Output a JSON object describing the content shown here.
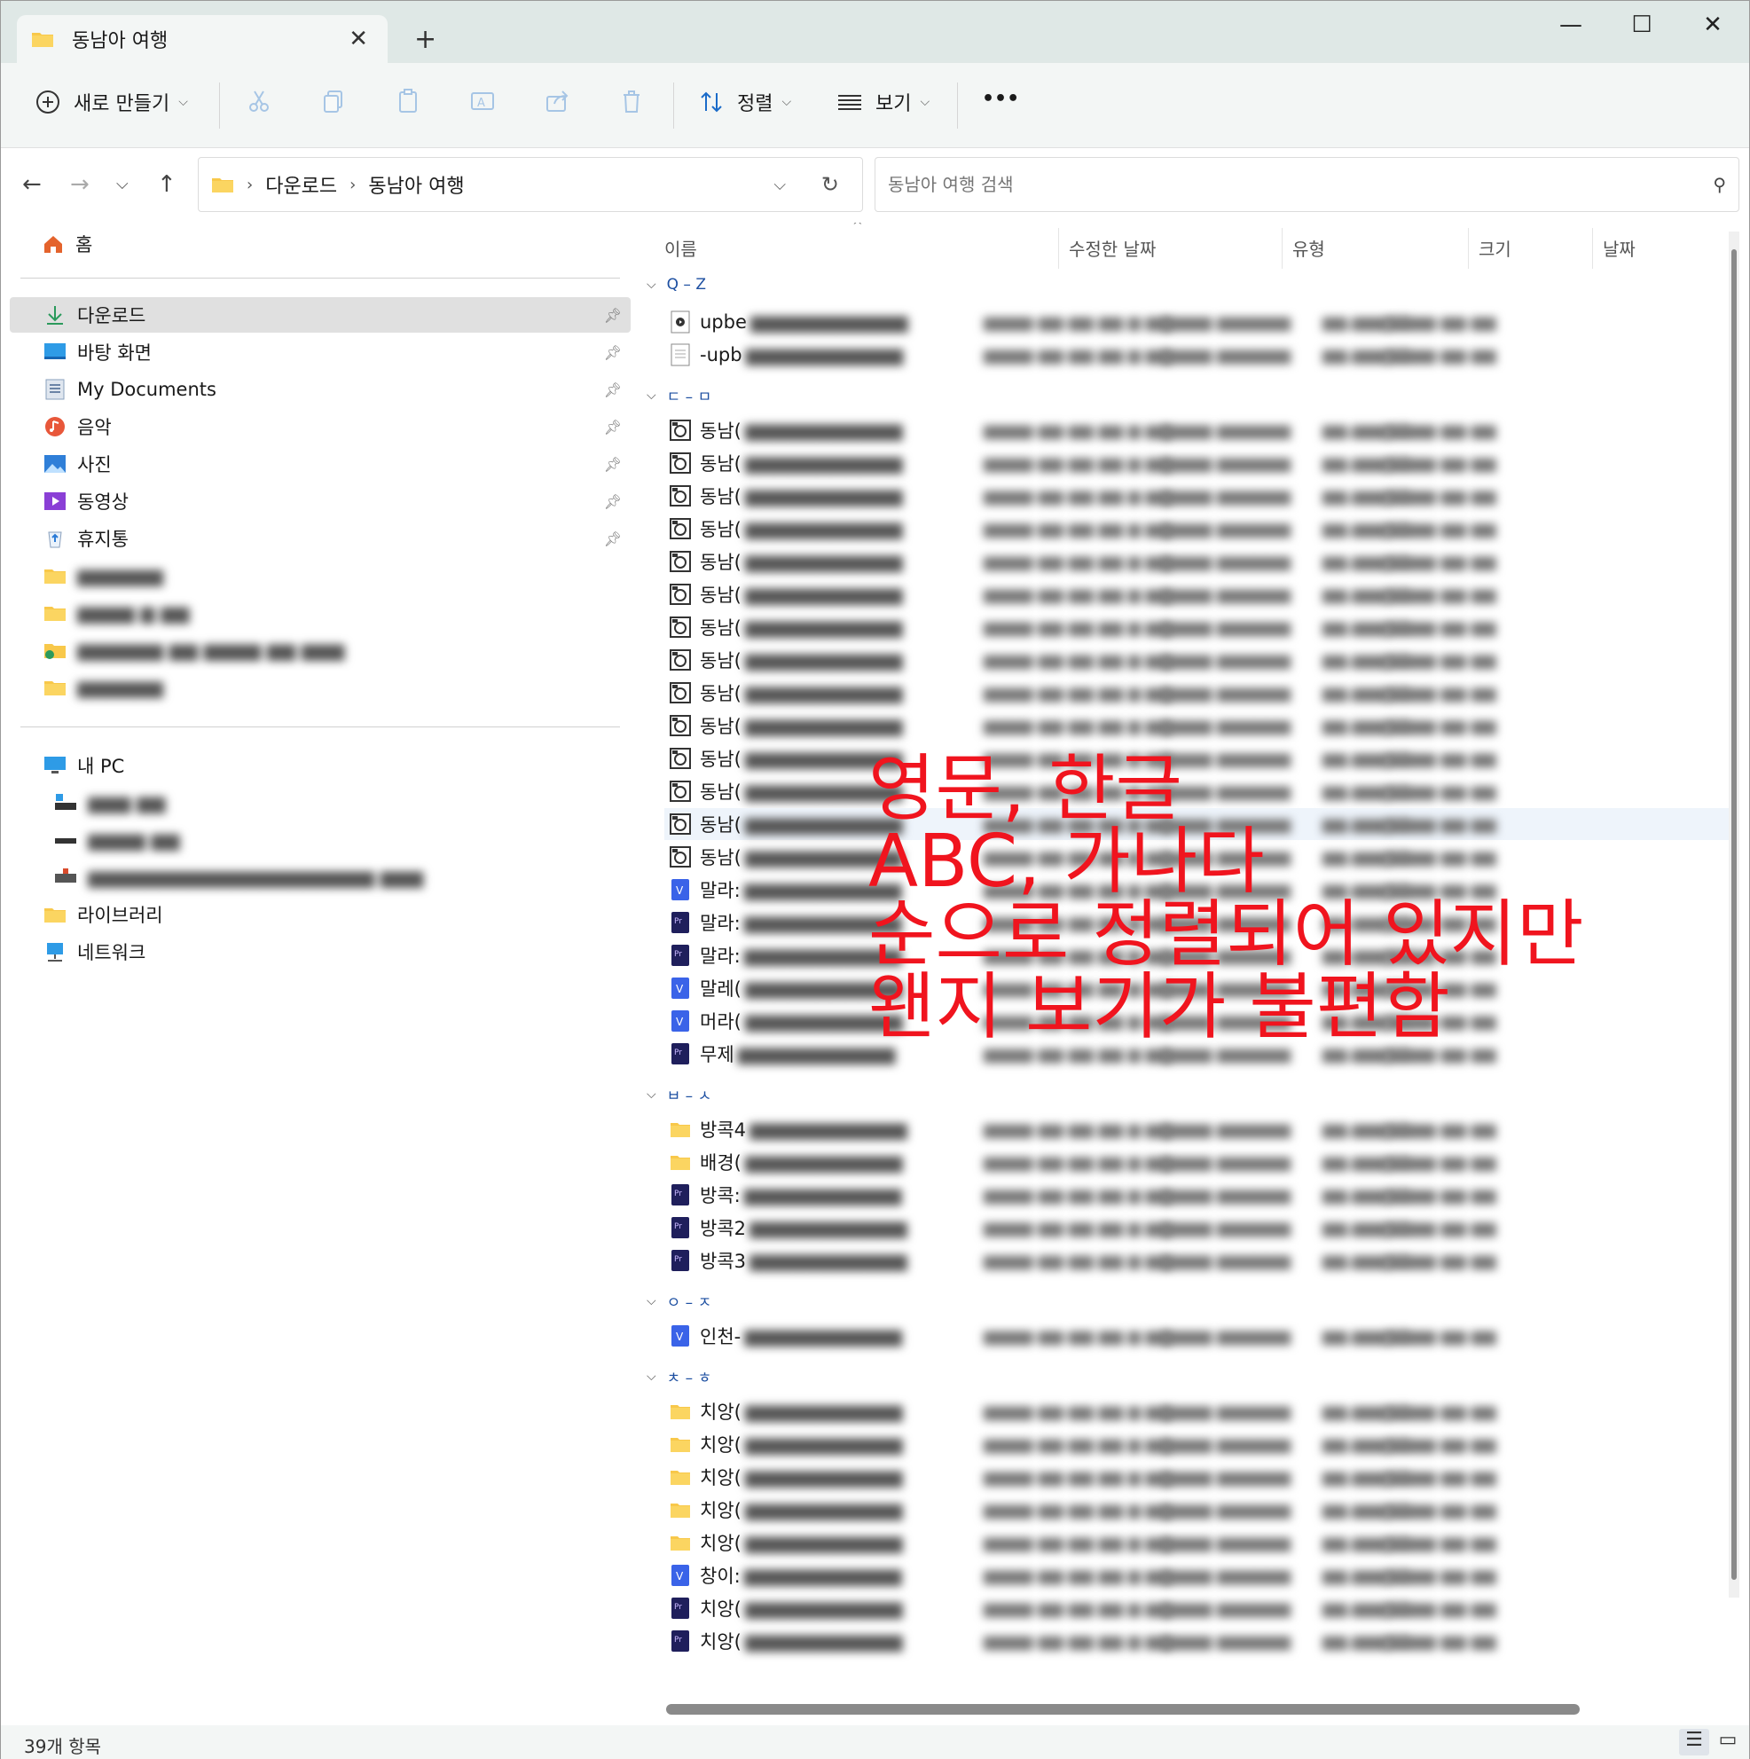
{
  "tab": {
    "title": "동남아 여행",
    "close": "✕",
    "new_tab": "+"
  },
  "window_controls": {
    "minimize": "—",
    "maximize": "☐",
    "close": "✕"
  },
  "commands": {
    "new": "새로 만들기",
    "sort": "정렬",
    "view": "보기",
    "more": "•••"
  },
  "address": {
    "crumbs": [
      "다운로드",
      "동남아 여행"
    ],
    "separator": "›"
  },
  "search": {
    "placeholder": "동남아 여행 검색"
  },
  "sidebar": {
    "home": "홈",
    "quick": [
      {
        "label": "다운로드",
        "icon": "download-icon",
        "pinned": true
      },
      {
        "label": "바탕 화면",
        "icon": "desktop-icon",
        "pinned": true
      },
      {
        "label": "My Documents",
        "icon": "documents-icon",
        "pinned": true
      },
      {
        "label": "음악",
        "icon": "music-icon",
        "pinned": true
      },
      {
        "label": "사진",
        "icon": "pictures-icon",
        "pinned": true
      },
      {
        "label": "동영상",
        "icon": "videos-icon",
        "pinned": true
      },
      {
        "label": "휴지통",
        "icon": "recycle-bin-icon",
        "pinned": true
      }
    ],
    "this_pc": "내 PC",
    "library": "라이브러리",
    "network": "네트워크"
  },
  "columns": {
    "name": "이름",
    "modified": "수정한 날짜",
    "type": "유형",
    "size": "크기",
    "date": "날짜"
  },
  "groups": [
    {
      "label": "Q – Z",
      "files": [
        {
          "name": "upbe",
          "icon": "media-file-icon"
        },
        {
          "name": "-upb",
          "icon": "text-file-icon"
        }
      ]
    },
    {
      "label": "ㄷ – ㅁ",
      "files": [
        {
          "name": "동남(",
          "icon": "image-file-icon"
        },
        {
          "name": "동남(",
          "icon": "image-file-icon"
        },
        {
          "name": "동남(",
          "icon": "image-file-icon"
        },
        {
          "name": "동남(",
          "icon": "image-file-icon"
        },
        {
          "name": "동남(",
          "icon": "image-file-icon"
        },
        {
          "name": "동남(",
          "icon": "image-file-icon"
        },
        {
          "name": "동남(",
          "icon": "image-file-icon"
        },
        {
          "name": "동남(",
          "icon": "image-file-icon"
        },
        {
          "name": "동남(",
          "icon": "image-file-icon"
        },
        {
          "name": "동남(",
          "icon": "image-file-icon"
        },
        {
          "name": "동남(",
          "icon": "image-file-icon"
        },
        {
          "name": "동남(",
          "icon": "image-file-icon"
        },
        {
          "name": "동남(",
          "icon": "image-file-icon"
        },
        {
          "name": "동남(",
          "icon": "image-file-icon"
        },
        {
          "name": "말라:",
          "icon": "vrew-file-icon"
        },
        {
          "name": "말라:",
          "icon": "premiere-file-icon"
        },
        {
          "name": "말라:",
          "icon": "premiere-file-icon"
        },
        {
          "name": "말레(",
          "icon": "vrew-file-icon"
        },
        {
          "name": "머라(",
          "icon": "vrew-file-icon"
        },
        {
          "name": "무제",
          "icon": "premiere-file-icon"
        }
      ]
    },
    {
      "label": "ㅂ – ㅅ",
      "files": [
        {
          "name": "방콕4",
          "icon": "folder-icon"
        },
        {
          "name": "배경(",
          "icon": "folder-icon"
        },
        {
          "name": "방콕:",
          "icon": "premiere-file-icon"
        },
        {
          "name": "방콕2",
          "icon": "premiere-file-icon"
        },
        {
          "name": "방콕3",
          "icon": "premiere-file-icon"
        }
      ]
    },
    {
      "label": "ㅇ – ㅈ",
      "files": [
        {
          "name": "인천-",
          "icon": "vrew-file-icon"
        }
      ]
    },
    {
      "label": "ㅊ – ㅎ",
      "files": [
        {
          "name": "치앙(",
          "icon": "folder-icon"
        },
        {
          "name": "치앙(",
          "icon": "folder-icon"
        },
        {
          "name": "치앙(",
          "icon": "folder-icon"
        },
        {
          "name": "치앙(",
          "icon": "folder-icon"
        },
        {
          "name": "치앙(",
          "icon": "folder-icon"
        },
        {
          "name": "창이:",
          "icon": "vrew-file-icon"
        },
        {
          "name": "치앙(",
          "icon": "premiere-file-icon"
        },
        {
          "name": "치앙(",
          "icon": "premiere-file-icon"
        }
      ]
    }
  ],
  "status": {
    "count": "39개 항목"
  },
  "annotation": "영문, 한글\nABC, 가나다\n순으로 정렬되어 있지만\n왠지 보기가 불편함"
}
